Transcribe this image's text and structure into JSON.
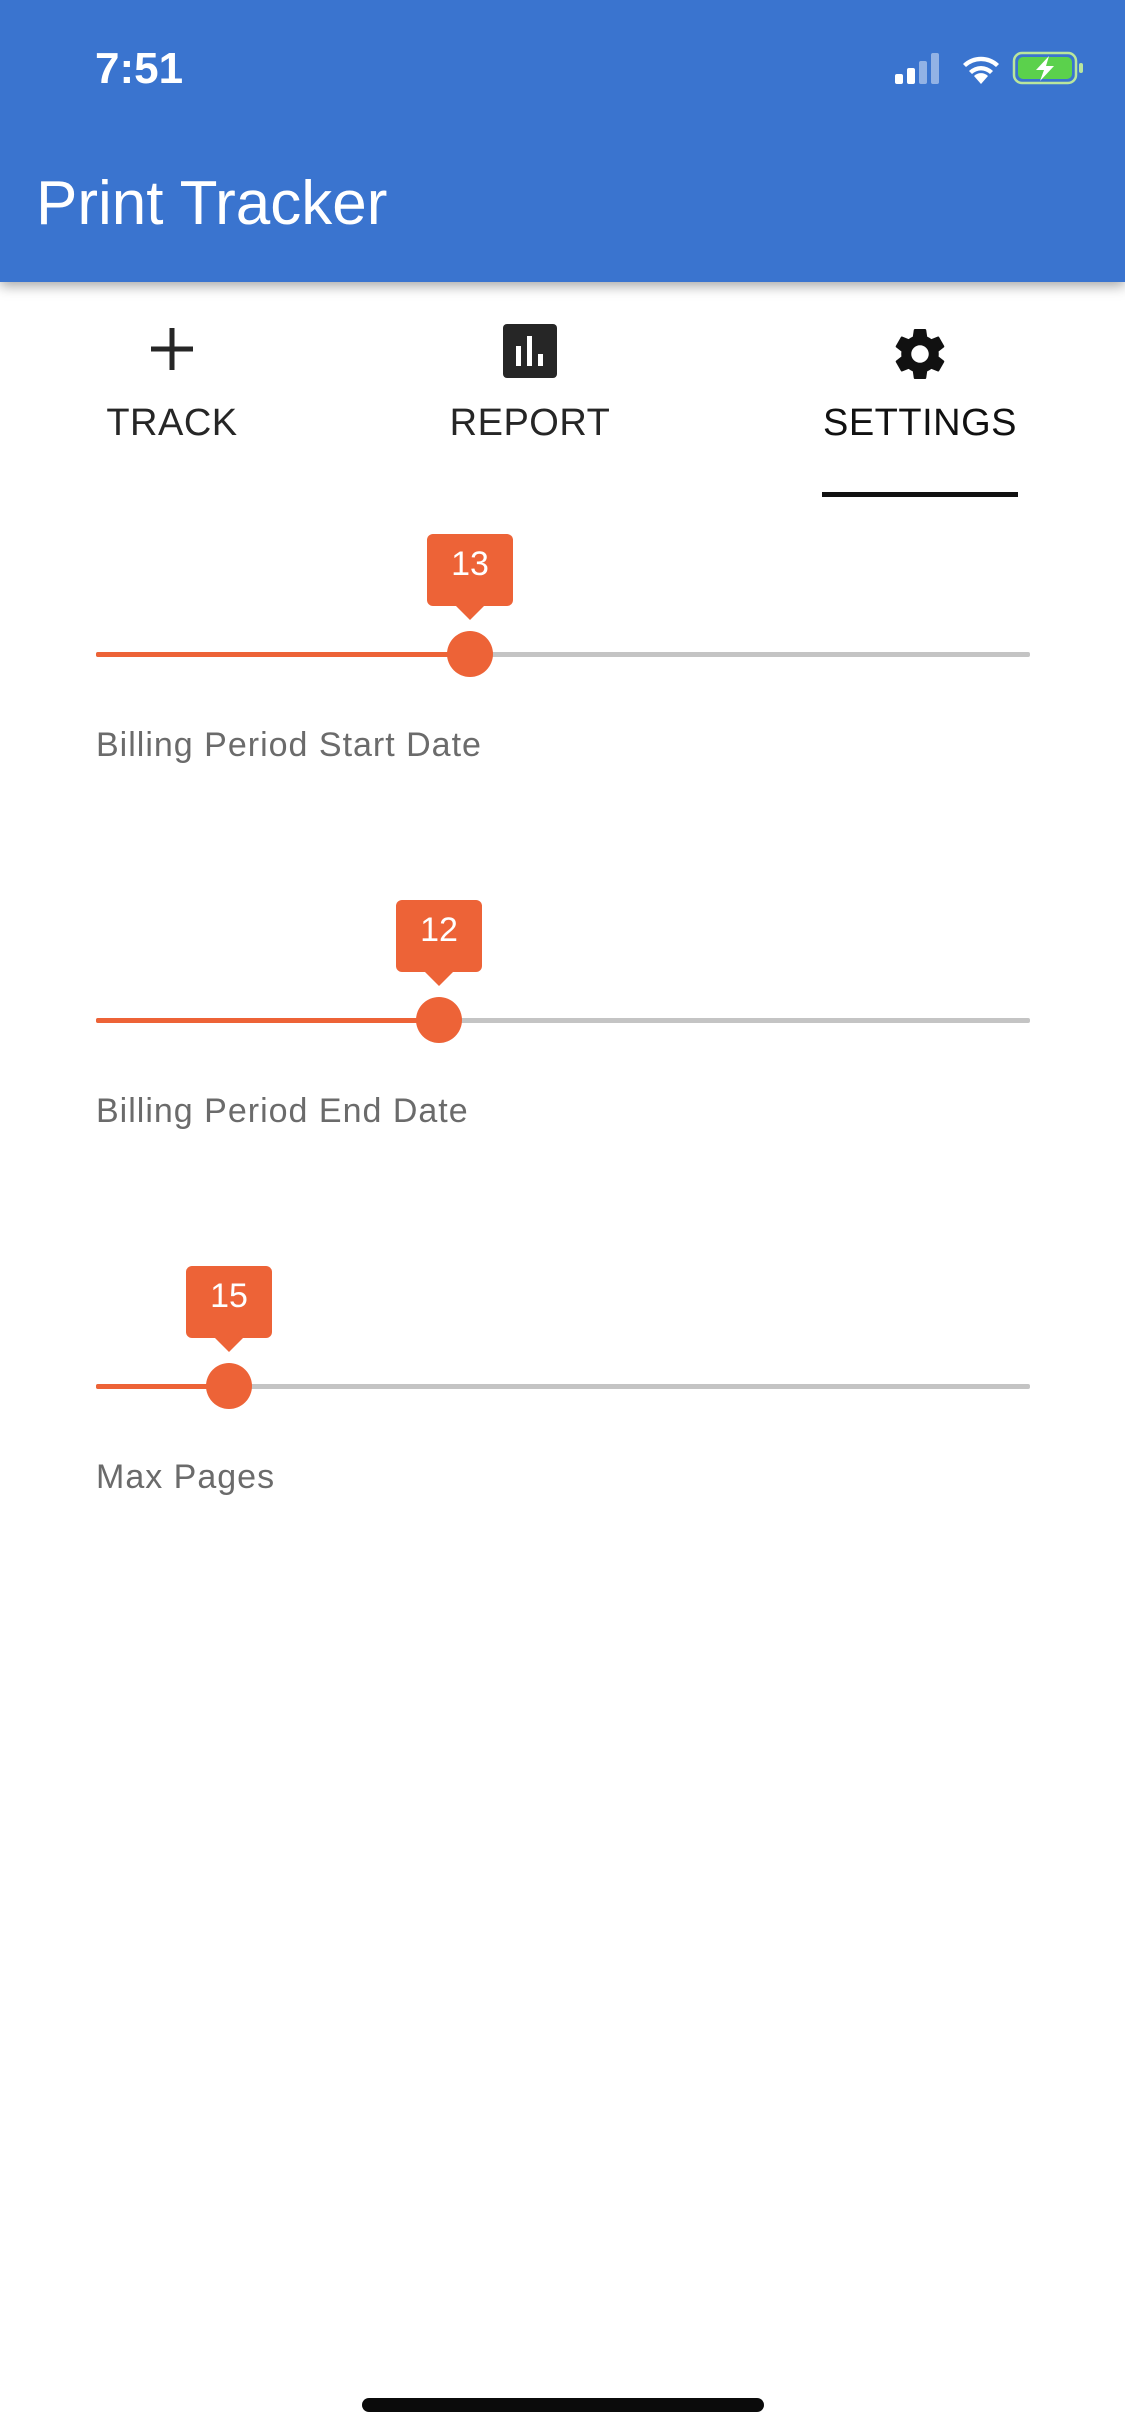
{
  "status_bar": {
    "time": "7:51"
  },
  "app": {
    "title": "Print Tracker"
  },
  "tabs": [
    {
      "label": "TRACK",
      "icon": "plus-icon",
      "selected": false
    },
    {
      "label": "REPORT",
      "icon": "bar-chart-icon",
      "selected": false
    },
    {
      "label": "SETTINGS",
      "icon": "gear-icon",
      "selected": true
    }
  ],
  "sliders": [
    {
      "label": "Billing Period Start Date",
      "value": "13",
      "fraction": 0.4
    },
    {
      "label": "Billing Period End Date",
      "value": "12",
      "fraction": 0.367
    },
    {
      "label": "Max Pages",
      "value": "15",
      "fraction": 0.142
    }
  ],
  "colors": {
    "appbar": "#3a74cf",
    "accent": "#ed6337",
    "track": "#c4c4c4"
  }
}
